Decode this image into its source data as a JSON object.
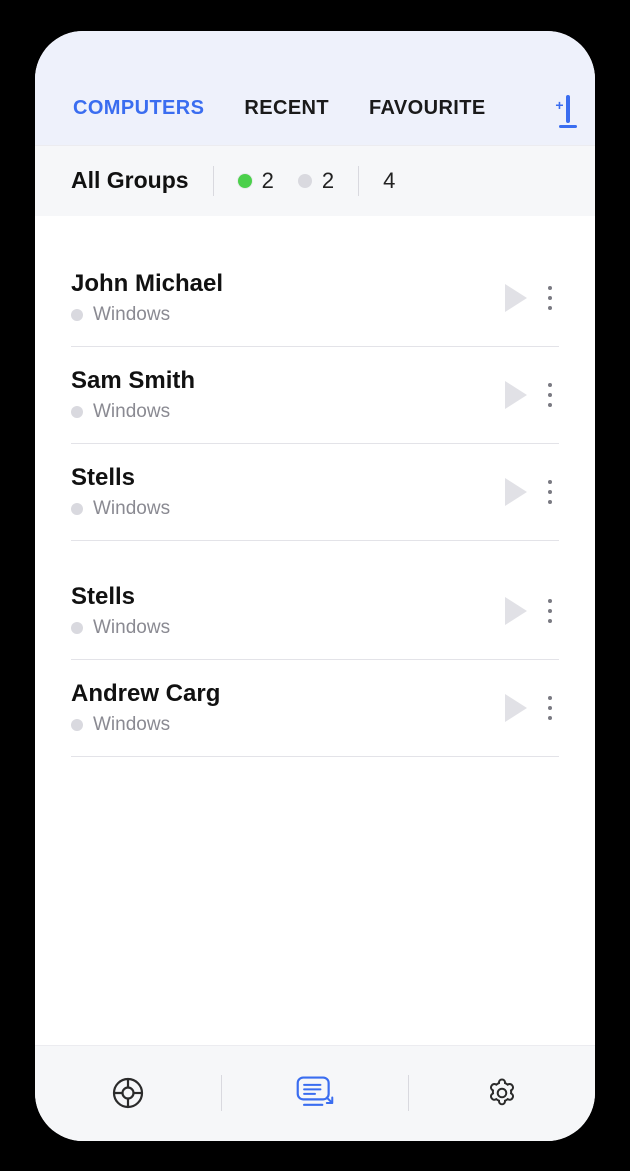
{
  "tabs": {
    "computers": "COMPUTERS",
    "recent": "RECENT",
    "favourite": "FAVOURITE",
    "active_index": 0
  },
  "summary": {
    "title": "All Groups",
    "online_count": "2",
    "offline_count": "2",
    "total_count": "4"
  },
  "computers": [
    {
      "name": "John Michael",
      "os": "Windows",
      "status": "offline"
    },
    {
      "name": "Sam Smith",
      "os": "Windows",
      "status": "offline"
    },
    {
      "name": "Stells",
      "os": "Windows",
      "status": "offline"
    },
    {
      "name": "Stells",
      "os": "Windows",
      "status": "offline"
    },
    {
      "name": "Andrew Carg",
      "os": "Windows",
      "status": "offline"
    }
  ],
  "colors": {
    "accent": "#3a6df0",
    "online": "#4bd04b",
    "offline": "#d9d9df"
  }
}
